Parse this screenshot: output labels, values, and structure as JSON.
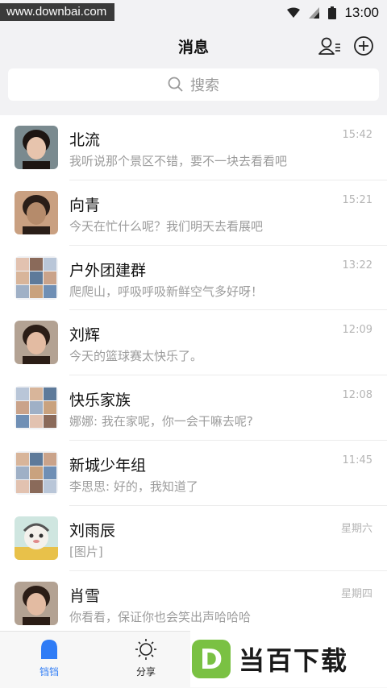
{
  "watermark": "www.downbai.com",
  "status": {
    "time": "13:00"
  },
  "header": {
    "title": "消息"
  },
  "search": {
    "placeholder": "搜索"
  },
  "conversations": [
    {
      "name": "北流",
      "preview": "我听说那个景区不错，要不一块去看看吧",
      "time": "15:42",
      "avatar": "portrait"
    },
    {
      "name": "向青",
      "preview": "今天在忙什么呢？我们明天去看展吧",
      "time": "15:21",
      "avatar": "portrait"
    },
    {
      "name": "户外团建群",
      "preview": "爬爬山，呼吸呼吸新鲜空气多好呀！",
      "time": "13:22",
      "avatar": "group"
    },
    {
      "name": "刘辉",
      "preview": "今天的篮球赛太快乐了。",
      "time": "12:09",
      "avatar": "portrait"
    },
    {
      "name": "快乐家族",
      "preview": "娜娜: 我在家呢，你一会干嘛去呢?",
      "time": "12:08",
      "avatar": "group"
    },
    {
      "name": "新城少年组",
      "preview": "李思思: 好的，我知道了",
      "time": "11:45",
      "avatar": "group"
    },
    {
      "name": "刘雨辰",
      "preview": "[图片]",
      "time": "星期六",
      "avatar": "cartoon"
    },
    {
      "name": "肖雪",
      "preview": "你看看，保证你也会笑出声哈哈哈",
      "time": "星期四",
      "avatar": "portrait"
    }
  ],
  "tabs": [
    {
      "label": "铛铛",
      "icon": "bell-icon",
      "active": true
    },
    {
      "label": "分享",
      "icon": "sun-icon",
      "active": false
    }
  ],
  "brand": {
    "logo_letter": "D",
    "text": "当百下载"
  },
  "colors": {
    "accent": "#2f7cf6",
    "brand_green": "#7ac143"
  }
}
